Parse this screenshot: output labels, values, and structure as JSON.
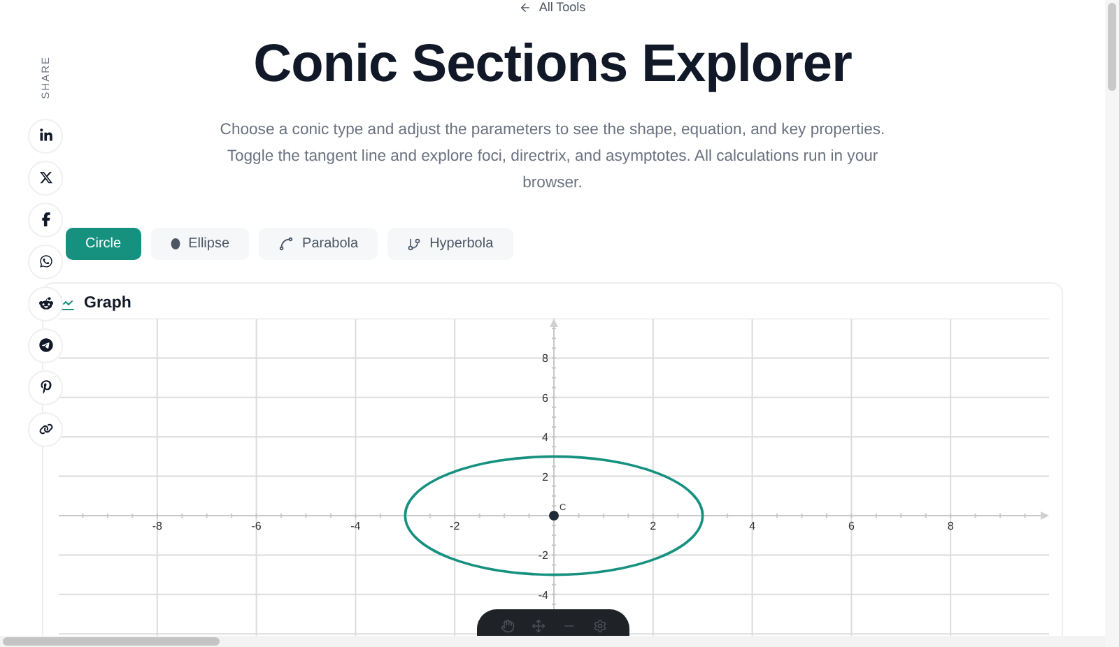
{
  "back_link": {
    "label": "All Tools"
  },
  "title": "Conic Sections Explorer",
  "description": "Choose a conic type and adjust the parameters to see the shape, equation, and key properties. Toggle the tangent line and explore foci, directrix, and asymptotes. All calculations run in your browser.",
  "share": {
    "label": "SHARE"
  },
  "tabs": [
    {
      "label": "Circle",
      "kind": "circle",
      "selected": true
    },
    {
      "label": "Ellipse",
      "kind": "ellipse",
      "selected": false
    },
    {
      "label": "Parabola",
      "kind": "parabola",
      "selected": false
    },
    {
      "label": "Hyperbola",
      "kind": "hyperbola",
      "selected": false
    }
  ],
  "graph": {
    "title": "Graph",
    "x_ticks": [
      "-8",
      "-6",
      "-4",
      "-2",
      "2",
      "4",
      "6",
      "8"
    ],
    "y_ticks": [
      "8",
      "6",
      "4",
      "2",
      "-2",
      "-4"
    ],
    "curve": {
      "kind": "circle",
      "center_label": "C"
    }
  }
}
